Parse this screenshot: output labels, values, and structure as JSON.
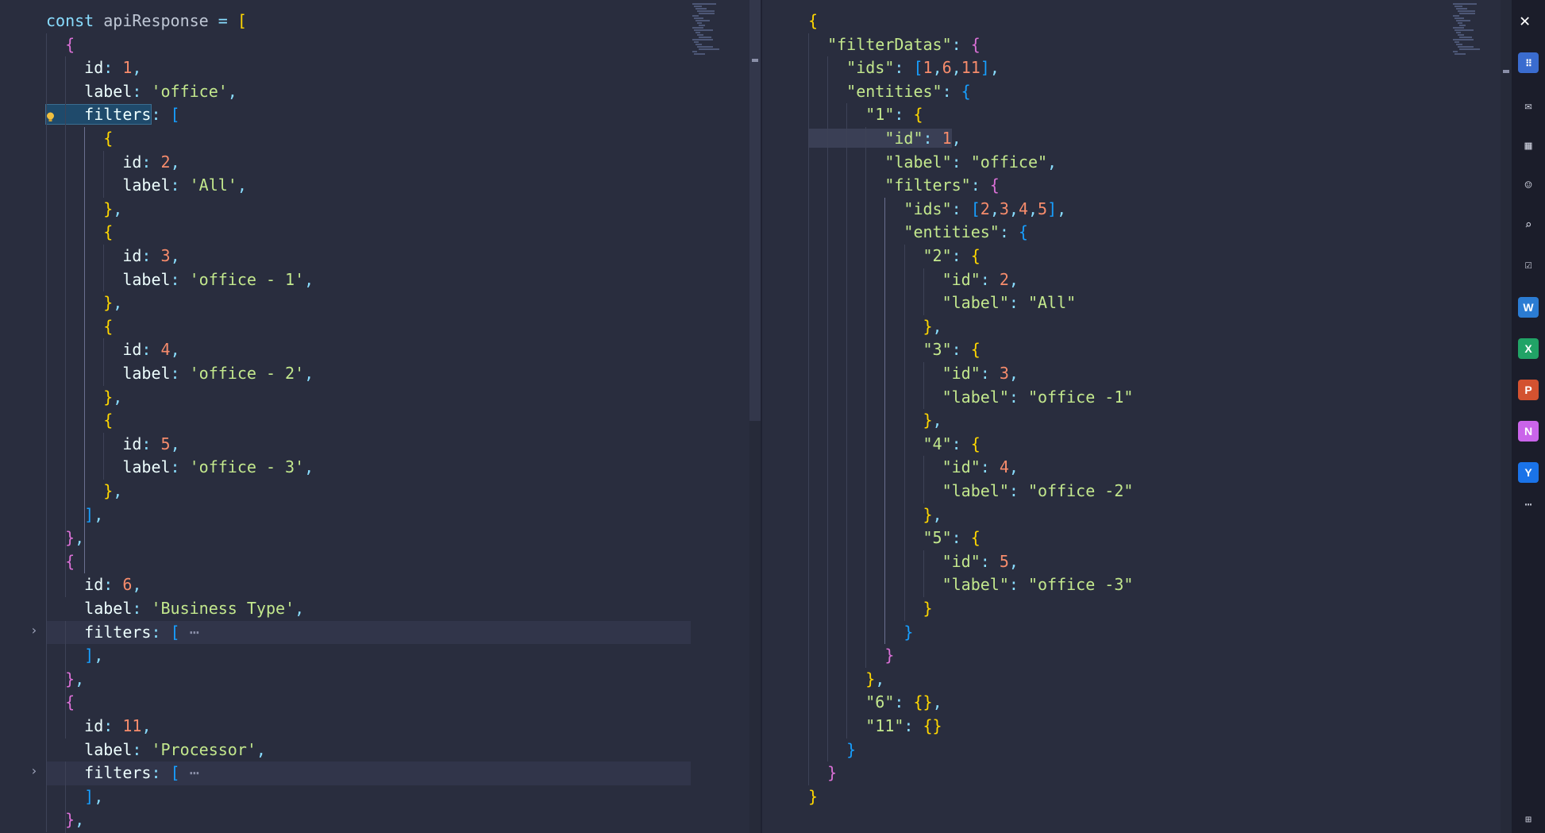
{
  "left_editor": {
    "lines": [
      [
        [
          "t-kw",
          "const "
        ],
        [
          "t-var",
          "apiResponse "
        ],
        [
          "t-op",
          "= "
        ],
        [
          "t-p1",
          "["
        ]
      ],
      [
        [
          "t-p2",
          "  {"
        ]
      ],
      [
        [
          "t-prop",
          "    id"
        ],
        [
          "t-op",
          ": "
        ],
        [
          "t-num",
          "1"
        ],
        [
          "t-op",
          ","
        ]
      ],
      [
        [
          "t-prop",
          "    label"
        ],
        [
          "t-op",
          ": "
        ],
        [
          "t-str",
          "'office'"
        ],
        [
          "t-op",
          ","
        ]
      ],
      [
        [
          "t-prop sel",
          "    filters"
        ],
        [
          "t-op",
          ": "
        ],
        [
          "t-p3",
          "["
        ]
      ],
      [
        [
          "t-p1",
          "      {"
        ]
      ],
      [
        [
          "t-prop",
          "        id"
        ],
        [
          "t-op",
          ": "
        ],
        [
          "t-num",
          "2"
        ],
        [
          "t-op",
          ","
        ]
      ],
      [
        [
          "t-prop",
          "        label"
        ],
        [
          "t-op",
          ": "
        ],
        [
          "t-str",
          "'All'"
        ],
        [
          "t-op",
          ","
        ]
      ],
      [
        [
          "t-p1",
          "      }"
        ],
        [
          "t-op",
          ","
        ]
      ],
      [
        [
          "t-p1",
          "      {"
        ]
      ],
      [
        [
          "t-prop",
          "        id"
        ],
        [
          "t-op",
          ": "
        ],
        [
          "t-num",
          "3"
        ],
        [
          "t-op",
          ","
        ]
      ],
      [
        [
          "t-prop",
          "        label"
        ],
        [
          "t-op",
          ": "
        ],
        [
          "t-str",
          "'office - 1'"
        ],
        [
          "t-op",
          ","
        ]
      ],
      [
        [
          "t-p1",
          "      }"
        ],
        [
          "t-op",
          ","
        ]
      ],
      [
        [
          "t-p1",
          "      {"
        ]
      ],
      [
        [
          "t-prop",
          "        id"
        ],
        [
          "t-op",
          ": "
        ],
        [
          "t-num",
          "4"
        ],
        [
          "t-op",
          ","
        ]
      ],
      [
        [
          "t-prop",
          "        label"
        ],
        [
          "t-op",
          ": "
        ],
        [
          "t-str",
          "'office - 2'"
        ],
        [
          "t-op",
          ","
        ]
      ],
      [
        [
          "t-p1",
          "      }"
        ],
        [
          "t-op",
          ","
        ]
      ],
      [
        [
          "t-p1",
          "      {"
        ]
      ],
      [
        [
          "t-prop",
          "        id"
        ],
        [
          "t-op",
          ": "
        ],
        [
          "t-num",
          "5"
        ],
        [
          "t-op",
          ","
        ]
      ],
      [
        [
          "t-prop",
          "        label"
        ],
        [
          "t-op",
          ": "
        ],
        [
          "t-str",
          "'office - 3'"
        ],
        [
          "t-op",
          ","
        ]
      ],
      [
        [
          "t-p1",
          "      }"
        ],
        [
          "t-op",
          ","
        ]
      ],
      [
        [
          "t-p3",
          "    ]"
        ],
        [
          "t-op",
          ","
        ]
      ],
      [
        [
          "t-p2",
          "  }"
        ],
        [
          "t-op",
          ","
        ]
      ],
      [
        [
          "t-p2",
          "  {"
        ]
      ],
      [
        [
          "t-prop",
          "    id"
        ],
        [
          "t-op",
          ": "
        ],
        [
          "t-num",
          "6"
        ],
        [
          "t-op",
          ","
        ]
      ],
      [
        [
          "t-prop",
          "    label"
        ],
        [
          "t-op",
          ": "
        ],
        [
          "t-str",
          "'Business Type'"
        ],
        [
          "t-op",
          ","
        ]
      ],
      [
        [
          "t-prop",
          "    filters"
        ],
        [
          "t-op",
          ": "
        ],
        [
          "t-p3",
          "["
        ],
        [
          "t-fold",
          " ⋯"
        ]
      ],
      [
        [
          "t-p3",
          "    ]"
        ],
        [
          "t-op",
          ","
        ]
      ],
      [
        [
          "t-p2",
          "  }"
        ],
        [
          "t-op",
          ","
        ]
      ],
      [
        [
          "t-p2",
          "  {"
        ]
      ],
      [
        [
          "t-prop",
          "    id"
        ],
        [
          "t-op",
          ": "
        ],
        [
          "t-num",
          "11"
        ],
        [
          "t-op",
          ","
        ]
      ],
      [
        [
          "t-prop",
          "    label"
        ],
        [
          "t-op",
          ": "
        ],
        [
          "t-str",
          "'Processor'"
        ],
        [
          "t-op",
          ","
        ]
      ],
      [
        [
          "t-prop",
          "    filters"
        ],
        [
          "t-op",
          ": "
        ],
        [
          "t-p3",
          "["
        ],
        [
          "t-fold",
          " ⋯"
        ]
      ],
      [
        [
          "t-p3",
          "    ]"
        ],
        [
          "t-op",
          ","
        ]
      ],
      [
        [
          "t-p2",
          "  }"
        ],
        [
          "t-op",
          ","
        ]
      ]
    ]
  },
  "right_editor": {
    "lines": [
      [
        [
          "t-p1",
          "{"
        ]
      ],
      [
        [
          "t-key",
          "  \"filterDatas\""
        ],
        [
          "t-op",
          ": "
        ],
        [
          "t-p2",
          "{"
        ]
      ],
      [
        [
          "t-key",
          "    \"ids\""
        ],
        [
          "t-op",
          ": "
        ],
        [
          "t-p3",
          "["
        ],
        [
          "t-num",
          "1"
        ],
        [
          "t-op",
          ","
        ],
        [
          "t-num",
          "6"
        ],
        [
          "t-op",
          ","
        ],
        [
          "t-num",
          "11"
        ],
        [
          "t-p3",
          "]"
        ],
        [
          "t-op",
          ","
        ]
      ],
      [
        [
          "t-key",
          "    \"entities\""
        ],
        [
          "t-op",
          ": "
        ],
        [
          "t-p3",
          "{"
        ]
      ],
      [
        [
          "t-key",
          "      \"1\""
        ],
        [
          "t-op",
          ": "
        ],
        [
          "t-p1",
          "{"
        ]
      ],
      [
        [
          "t-key cursor-box",
          "        \"id\""
        ],
        [
          "t-op cursor-box",
          ": "
        ],
        [
          "t-num cursor-box",
          "1"
        ],
        [
          "t-op",
          ","
        ]
      ],
      [
        [
          "t-key",
          "        \"label\""
        ],
        [
          "t-op",
          ": "
        ],
        [
          "t-str",
          "\"office\""
        ],
        [
          "t-op",
          ","
        ]
      ],
      [
        [
          "t-key",
          "        \"filters\""
        ],
        [
          "t-op",
          ": "
        ],
        [
          "t-p2",
          "{"
        ]
      ],
      [
        [
          "t-key",
          "          \"ids\""
        ],
        [
          "t-op",
          ": "
        ],
        [
          "t-p3",
          "["
        ],
        [
          "t-num",
          "2"
        ],
        [
          "t-op",
          ","
        ],
        [
          "t-num",
          "3"
        ],
        [
          "t-op",
          ","
        ],
        [
          "t-num",
          "4"
        ],
        [
          "t-op",
          ","
        ],
        [
          "t-num",
          "5"
        ],
        [
          "t-p3",
          "]"
        ],
        [
          "t-op",
          ","
        ]
      ],
      [
        [
          "t-key",
          "          \"entities\""
        ],
        [
          "t-op",
          ": "
        ],
        [
          "t-p3",
          "{"
        ]
      ],
      [
        [
          "t-key",
          "            \"2\""
        ],
        [
          "t-op",
          ": "
        ],
        [
          "t-p1",
          "{"
        ]
      ],
      [
        [
          "t-key",
          "              \"id\""
        ],
        [
          "t-op",
          ": "
        ],
        [
          "t-num",
          "2"
        ],
        [
          "t-op",
          ","
        ]
      ],
      [
        [
          "t-key",
          "              \"label\""
        ],
        [
          "t-op",
          ": "
        ],
        [
          "t-str",
          "\"All\""
        ]
      ],
      [
        [
          "t-p1",
          "            }"
        ],
        [
          "t-op",
          ","
        ]
      ],
      [
        [
          "t-key",
          "            \"3\""
        ],
        [
          "t-op",
          ": "
        ],
        [
          "t-p1",
          "{"
        ]
      ],
      [
        [
          "t-key",
          "              \"id\""
        ],
        [
          "t-op",
          ": "
        ],
        [
          "t-num",
          "3"
        ],
        [
          "t-op",
          ","
        ]
      ],
      [
        [
          "t-key",
          "              \"label\""
        ],
        [
          "t-op",
          ": "
        ],
        [
          "t-str",
          "\"office -1\""
        ]
      ],
      [
        [
          "t-p1",
          "            }"
        ],
        [
          "t-op",
          ","
        ]
      ],
      [
        [
          "t-key",
          "            \"4\""
        ],
        [
          "t-op",
          ": "
        ],
        [
          "t-p1",
          "{"
        ]
      ],
      [
        [
          "t-key",
          "              \"id\""
        ],
        [
          "t-op",
          ": "
        ],
        [
          "t-num",
          "4"
        ],
        [
          "t-op",
          ","
        ]
      ],
      [
        [
          "t-key",
          "              \"label\""
        ],
        [
          "t-op",
          ": "
        ],
        [
          "t-str",
          "\"office -2\""
        ]
      ],
      [
        [
          "t-p1",
          "            }"
        ],
        [
          "t-op",
          ","
        ]
      ],
      [
        [
          "t-key",
          "            \"5\""
        ],
        [
          "t-op",
          ": "
        ],
        [
          "t-p1",
          "{"
        ]
      ],
      [
        [
          "t-key",
          "              \"id\""
        ],
        [
          "t-op",
          ": "
        ],
        [
          "t-num",
          "5"
        ],
        [
          "t-op",
          ","
        ]
      ],
      [
        [
          "t-key",
          "              \"label\""
        ],
        [
          "t-op",
          ": "
        ],
        [
          "t-str",
          "\"office -3\""
        ]
      ],
      [
        [
          "t-p1",
          "            }"
        ]
      ],
      [
        [
          "t-p3",
          "          }"
        ]
      ],
      [
        [
          "t-p2",
          "        }"
        ]
      ],
      [
        [
          "t-p1",
          "      }"
        ],
        [
          "t-op",
          ","
        ]
      ],
      [
        [
          "t-key",
          "      \"6\""
        ],
        [
          "t-op",
          ": "
        ],
        [
          "t-p1",
          "{}"
        ],
        [
          "t-op",
          ","
        ]
      ],
      [
        [
          "t-key",
          "      \"11\""
        ],
        [
          "t-op",
          ": "
        ],
        [
          "t-p1",
          "{}"
        ]
      ],
      [
        [
          "t-p3",
          "    }"
        ]
      ],
      [
        [
          "t-p2",
          "  }"
        ]
      ],
      [
        [
          "t-p1",
          "}"
        ]
      ]
    ]
  },
  "taskbar": {
    "close_glyph": "✕",
    "apps": [
      {
        "name": "word",
        "letter": "W",
        "color": "#2b7cd3"
      },
      {
        "name": "excel",
        "letter": "X",
        "color": "#21a366"
      },
      {
        "name": "powerpoint",
        "letter": "P",
        "color": "#d35230"
      },
      {
        "name": "onenote",
        "letter": "N",
        "color": "#ca64ea"
      },
      {
        "name": "yammer",
        "letter": "Y",
        "color": "#1a73e8"
      }
    ],
    "more_glyph": "⋯"
  }
}
